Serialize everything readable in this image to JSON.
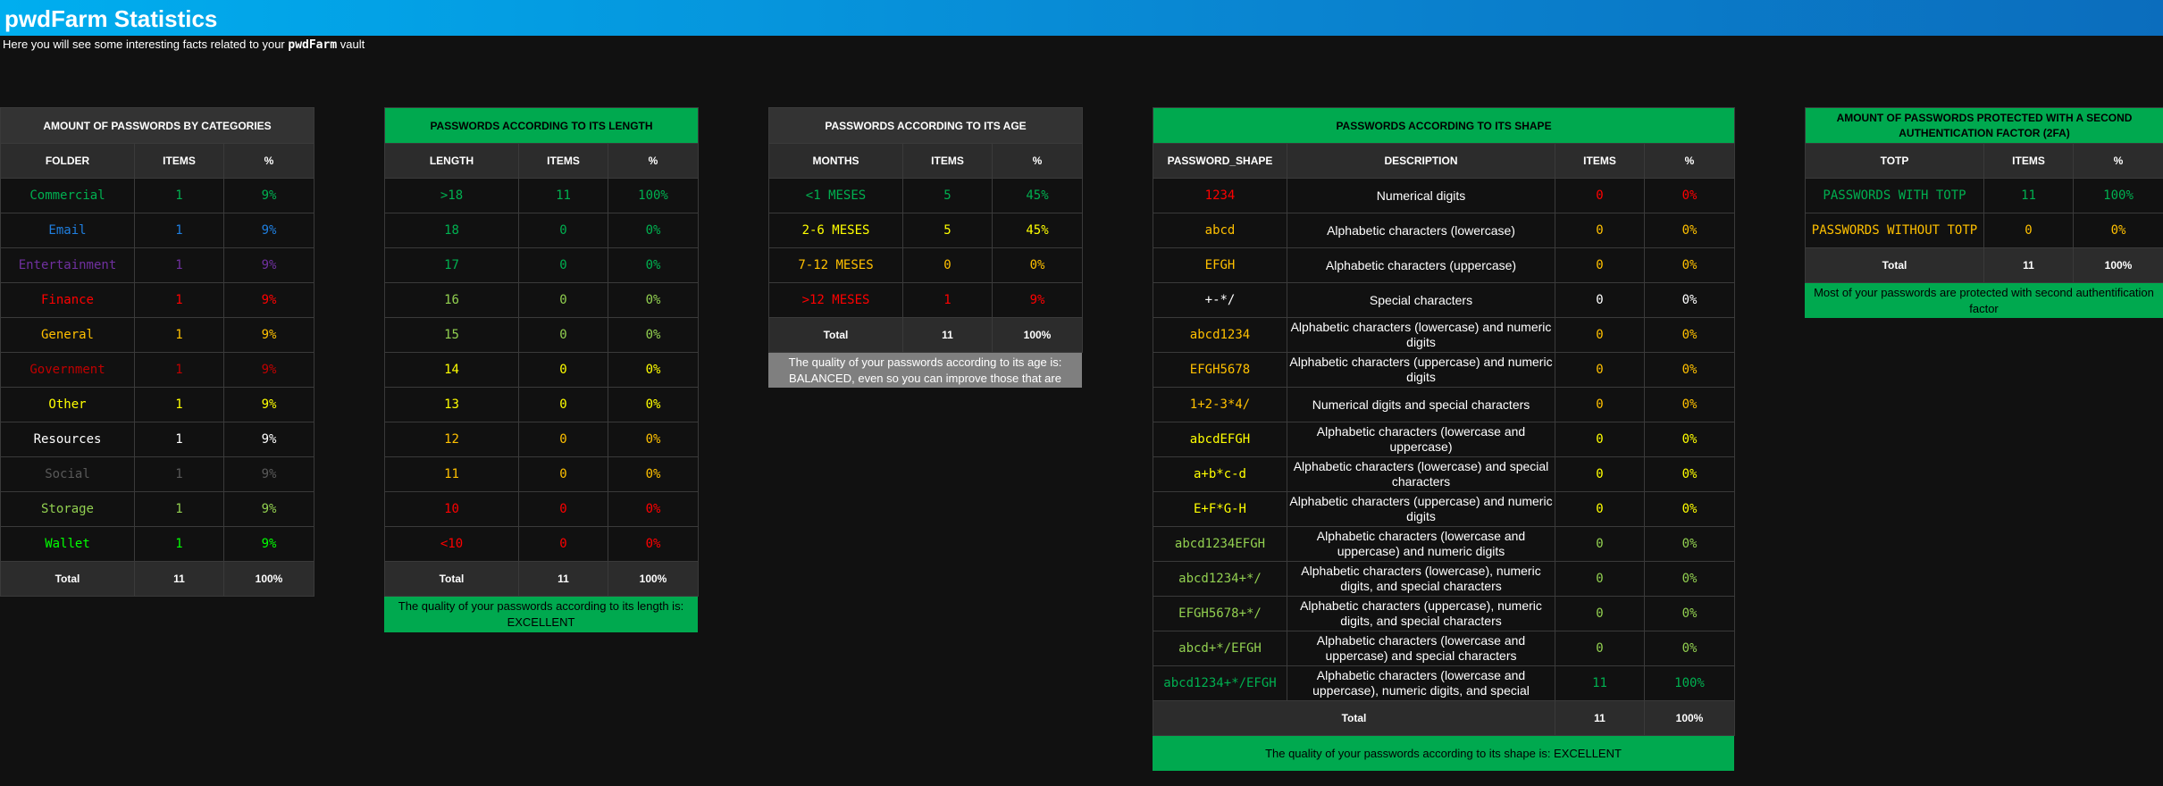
{
  "header": {
    "title": "pwdFarm Statistics",
    "subtitle_pre": "Here you will see some interesting facts related to your ",
    "subtitle_brand": "pwdFarm",
    "subtitle_post": " vault"
  },
  "categories": {
    "title": "AMOUNT OF PASSWORDS BY CATEGORIES",
    "headers": [
      "FOLDER",
      "ITEMS",
      "%"
    ],
    "rows": [
      {
        "label": "Commercial",
        "items": "1",
        "pct": "9%",
        "color": "#00b050"
      },
      {
        "label": "Email",
        "items": "1",
        "pct": "9%",
        "color": "#1f7fe0"
      },
      {
        "label": "Entertainment",
        "items": "1",
        "pct": "9%",
        "color": "#7030a0"
      },
      {
        "label": "Finance",
        "items": "1",
        "pct": "9%",
        "color": "#ff0000"
      },
      {
        "label": "General",
        "items": "1",
        "pct": "9%",
        "color": "#ffc000"
      },
      {
        "label": "Government",
        "items": "1",
        "pct": "9%",
        "color": "#c00000"
      },
      {
        "label": "Other",
        "items": "1",
        "pct": "9%",
        "color": "#ffff00"
      },
      {
        "label": "Resources",
        "items": "1",
        "pct": "9%",
        "color": "#ffffff"
      },
      {
        "label": "Social",
        "items": "1",
        "pct": "9%",
        "color": "#595959"
      },
      {
        "label": "Storage",
        "items": "1",
        "pct": "9%",
        "color": "#92d050"
      },
      {
        "label": "Wallet",
        "items": "1",
        "pct": "9%",
        "color": "#00ff00"
      }
    ],
    "total": {
      "label": "Total",
      "items": "11",
      "pct": "100%"
    }
  },
  "length": {
    "title": "PASSWORDS ACCORDING TO ITS LENGTH",
    "headers": [
      "LENGTH",
      "ITEMS",
      "%"
    ],
    "rows": [
      {
        "label": ">18",
        "items": "11",
        "pct": "100%",
        "color": "#00b050"
      },
      {
        "label": "18",
        "items": "0",
        "pct": "0%",
        "color": "#00b050"
      },
      {
        "label": "17",
        "items": "0",
        "pct": "0%",
        "color": "#00b050"
      },
      {
        "label": "16",
        "items": "0",
        "pct": "0%",
        "color": "#92d050"
      },
      {
        "label": "15",
        "items": "0",
        "pct": "0%",
        "color": "#92d050"
      },
      {
        "label": "14",
        "items": "0",
        "pct": "0%",
        "color": "#ffff00"
      },
      {
        "label": "13",
        "items": "0",
        "pct": "0%",
        "color": "#ffff00"
      },
      {
        "label": "12",
        "items": "0",
        "pct": "0%",
        "color": "#ffc000"
      },
      {
        "label": "11",
        "items": "0",
        "pct": "0%",
        "color": "#ffc000"
      },
      {
        "label": "10",
        "items": "0",
        "pct": "0%",
        "color": "#ff0000"
      },
      {
        "label": "<10",
        "items": "0",
        "pct": "0%",
        "color": "#ff0000"
      }
    ],
    "total": {
      "label": "Total",
      "items": "11",
      "pct": "100%"
    },
    "note": "The quality of your passwords according to its length is: EXCELLENT"
  },
  "age": {
    "title": "PASSWORDS ACCORDING TO ITS AGE",
    "headers": [
      "MONTHS",
      "ITEMS",
      "%"
    ],
    "rows": [
      {
        "label": "<1 MESES",
        "items": "5",
        "pct": "45%",
        "color": "#00b050"
      },
      {
        "label": "2-6 MESES",
        "items": "5",
        "pct": "45%",
        "color": "#ffff00"
      },
      {
        "label": "7-12 MESES",
        "items": "0",
        "pct": "0%",
        "color": "#ffc000"
      },
      {
        "label": ">12 MESES",
        "items": "1",
        "pct": "9%",
        "color": "#ff0000"
      }
    ],
    "total": {
      "label": "Total",
      "items": "11",
      "pct": "100%"
    },
    "note": "The quality of your passwords according to its age is: BALANCED, even so you can improve those that are"
  },
  "shape": {
    "title": "PASSWORDS ACCORDING TO ITS SHAPE",
    "headers": [
      "PASSWORD_SHAPE",
      "DESCRIPTION",
      "ITEMS",
      "%"
    ],
    "rows": [
      {
        "label": "1234",
        "desc": "Numerical digits",
        "items": "0",
        "pct": "0%",
        "color": "#ff0000"
      },
      {
        "label": "abcd",
        "desc": "Alphabetic characters (lowercase)",
        "items": "0",
        "pct": "0%",
        "color": "#ffc000"
      },
      {
        "label": "EFGH",
        "desc": "Alphabetic characters (uppercase)",
        "items": "0",
        "pct": "0%",
        "color": "#ffc000"
      },
      {
        "label": "+-*/",
        "desc": "Special characters",
        "items": "0",
        "pct": "0%",
        "color": "#ffffff"
      },
      {
        "label": "abcd1234",
        "desc": "Alphabetic characters (lowercase) and numeric digits",
        "items": "0",
        "pct": "0%",
        "color": "#ffc000"
      },
      {
        "label": "EFGH5678",
        "desc": "Alphabetic characters (uppercase) and numeric digits",
        "items": "0",
        "pct": "0%",
        "color": "#ffc000"
      },
      {
        "label": "1+2-3*4/",
        "desc": "Numerical digits and special characters",
        "items": "0",
        "pct": "0%",
        "color": "#ffc000"
      },
      {
        "label": "abcdEFGH",
        "desc": "Alphabetic characters (lowercase and uppercase)",
        "items": "0",
        "pct": "0%",
        "color": "#ffff00"
      },
      {
        "label": "a+b*c-d",
        "desc": "Alphabetic characters (lowercase) and special characters",
        "items": "0",
        "pct": "0%",
        "color": "#ffff00"
      },
      {
        "label": "E+F*G-H",
        "desc": "Alphabetic characters (uppercase) and numeric digits",
        "items": "0",
        "pct": "0%",
        "color": "#ffff00"
      },
      {
        "label": "abcd1234EFGH",
        "desc": "Alphabetic characters (lowercase and uppercase) and numeric digits",
        "items": "0",
        "pct": "0%",
        "color": "#92d050"
      },
      {
        "label": "abcd1234+*/",
        "desc": "Alphabetic characters (lowercase), numeric digits, and special characters",
        "items": "0",
        "pct": "0%",
        "color": "#92d050"
      },
      {
        "label": "EFGH5678+*/",
        "desc": "Alphabetic characters (uppercase), numeric digits, and special characters",
        "items": "0",
        "pct": "0%",
        "color": "#92d050"
      },
      {
        "label": "abcd+*/EFGH",
        "desc": "Alphabetic characters (lowercase and uppercase) and special characters",
        "items": "0",
        "pct": "0%",
        "color": "#92d050"
      },
      {
        "label": "abcd1234+*/EFGH",
        "desc": "Alphabetic characters (lowercase and uppercase), numeric digits, and special",
        "items": "11",
        "pct": "100%",
        "color": "#00b050"
      }
    ],
    "total": {
      "label": "Total",
      "items": "11",
      "pct": "100%"
    },
    "note": "The quality of your passwords according to its shape is: EXCELLENT"
  },
  "twofa": {
    "title": "AMOUNT OF PASSWORDS PROTECTED WITH A SECOND AUTHENTICATION FACTOR (2FA)",
    "headers": [
      "TOTP",
      "ITEMS",
      "%"
    ],
    "rows": [
      {
        "label": "PASSWORDS WITH TOTP",
        "items": "11",
        "pct": "100%",
        "color": "#00b050"
      },
      {
        "label": "PASSWORDS WITHOUT TOTP",
        "items": "0",
        "pct": "0%",
        "color": "#ffc000"
      }
    ],
    "total": {
      "label": "Total",
      "items": "11",
      "pct": "100%"
    },
    "note": "Most of your passwords are protected with second authentification factor"
  }
}
